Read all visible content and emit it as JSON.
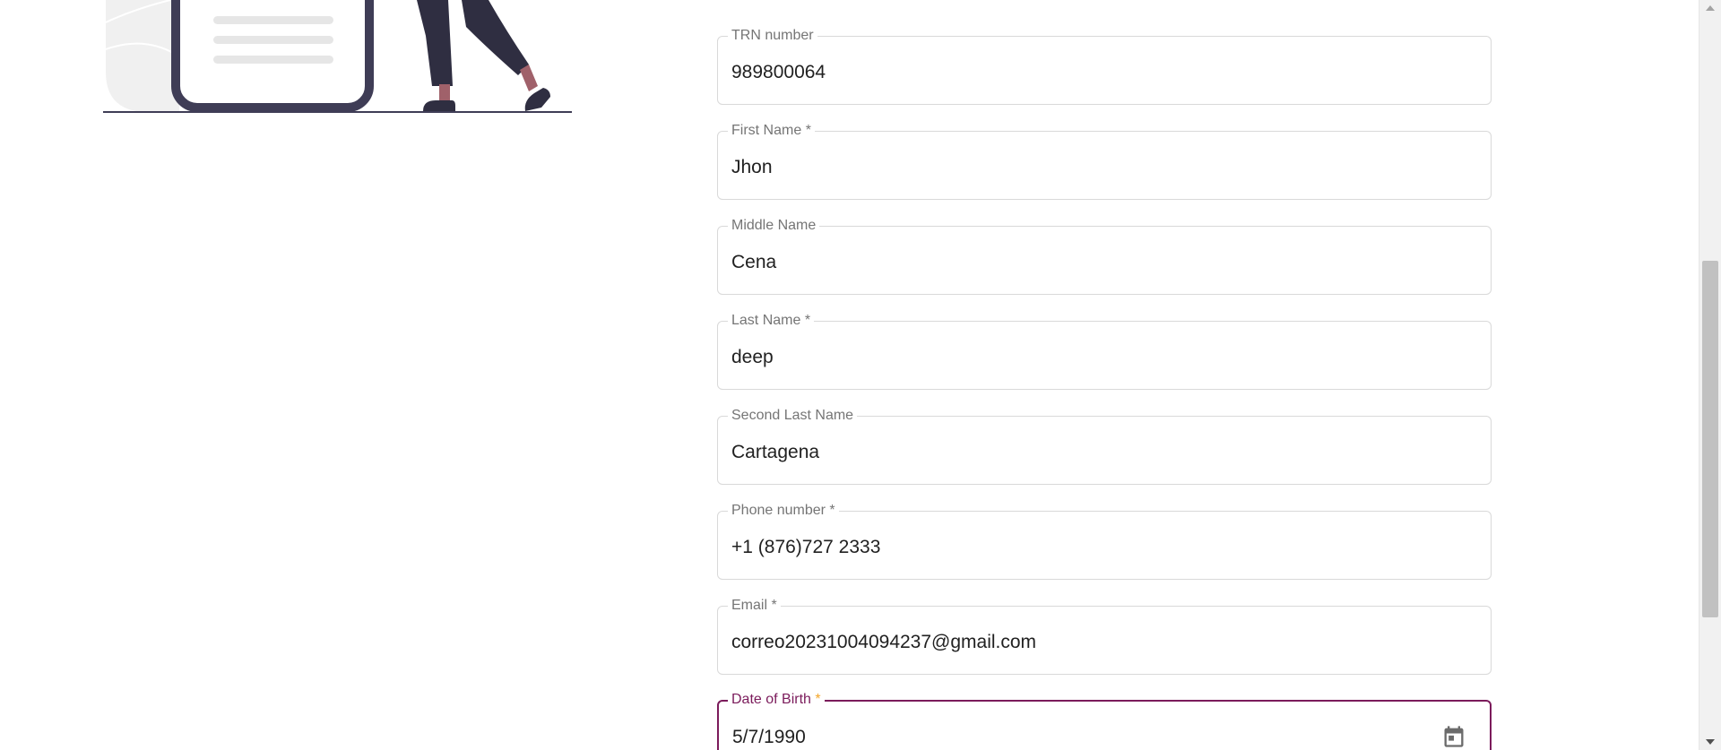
{
  "form": {
    "fields": [
      {
        "label": "TRN number",
        "value": "989800064",
        "required": false
      },
      {
        "label": "First Name",
        "value": "Jhon",
        "required": true
      },
      {
        "label": "Middle Name",
        "value": "Cena",
        "required": false
      },
      {
        "label": "Last Name",
        "value": "deep",
        "required": true
      },
      {
        "label": "Second Last Name",
        "value": "Cartagena",
        "required": false
      },
      {
        "label": "Phone number",
        "value": "+1 (876)727 2333",
        "required": true
      },
      {
        "label": "Email",
        "value": "correo20231004094237@gmail.com",
        "required": true
      },
      {
        "label": "Date of Birth",
        "value": "5/7/1990",
        "required": true
      }
    ],
    "required_marker": "*",
    "focused_field": "Date of Birth",
    "calendar_icon": "calendar-icon"
  },
  "colors": {
    "focus_border": "#7b1b5b",
    "required_star_focused": "#f4a62a",
    "field_border": "#d9d9d9",
    "label": "#757575",
    "value_text": "#212121",
    "illustration_dark": "#3f3d56",
    "illustration_skin": "#a0616a",
    "illustration_light": "#f0f0f0"
  }
}
